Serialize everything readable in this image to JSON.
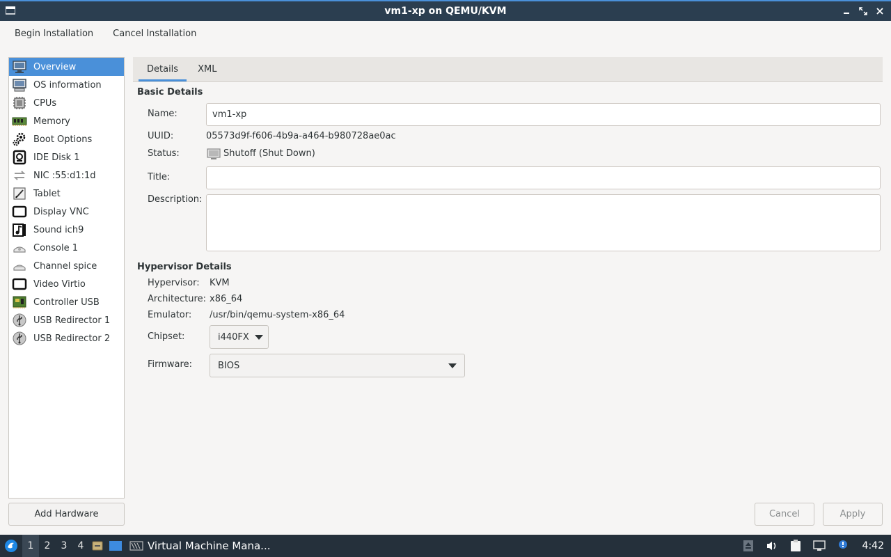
{
  "window": {
    "title": "vm1-xp on QEMU/KVM"
  },
  "menu": {
    "begin_install": "Begin Installation",
    "cancel_install": "Cancel Installation"
  },
  "sidebar": {
    "items": [
      {
        "label": "Overview",
        "icon": "monitor-icon"
      },
      {
        "label": "OS information",
        "icon": "os-info-icon"
      },
      {
        "label": "CPUs",
        "icon": "cpu-icon"
      },
      {
        "label": "Memory",
        "icon": "memory-icon"
      },
      {
        "label": "Boot Options",
        "icon": "gear-icon"
      },
      {
        "label": "IDE Disk 1",
        "icon": "disk-icon"
      },
      {
        "label": "NIC :55:d1:1d",
        "icon": "network-icon"
      },
      {
        "label": "Tablet",
        "icon": "tablet-icon"
      },
      {
        "label": "Display VNC",
        "icon": "display-icon"
      },
      {
        "label": "Sound ich9",
        "icon": "sound-icon"
      },
      {
        "label": "Console 1",
        "icon": "console-icon"
      },
      {
        "label": "Channel spice",
        "icon": "channel-icon"
      },
      {
        "label": "Video Virtio",
        "icon": "video-icon"
      },
      {
        "label": "Controller USB",
        "icon": "controller-icon"
      },
      {
        "label": "USB Redirector 1",
        "icon": "usb-icon"
      },
      {
        "label": "USB Redirector 2",
        "icon": "usb-icon"
      }
    ],
    "add_hardware": "Add Hardware"
  },
  "tabs": {
    "details": "Details",
    "xml": "XML"
  },
  "basic": {
    "heading": "Basic Details",
    "name_label": "Name:",
    "name_value": "vm1-xp",
    "uuid_label": "UUID:",
    "uuid_value": "05573d9f-f606-4b9a-a464-b980728ae0ac",
    "status_label": "Status:",
    "status_value": "Shutoff (Shut Down)",
    "title_label": "Title:",
    "title_value": "",
    "description_label": "Description:",
    "description_value": ""
  },
  "hypervisor": {
    "heading": "Hypervisor Details",
    "hypervisor_label": "Hypervisor:",
    "hypervisor_value": "KVM",
    "arch_label": "Architecture:",
    "arch_value": "x86_64",
    "emulator_label": "Emulator:",
    "emulator_value": "/usr/bin/qemu-system-x86_64",
    "chipset_label": "Chipset:",
    "chipset_value": "i440FX",
    "firmware_label": "Firmware:",
    "firmware_value": "BIOS"
  },
  "buttons": {
    "cancel": "Cancel",
    "apply": "Apply"
  },
  "taskbar": {
    "workspaces": [
      "1",
      "2",
      "3",
      "4"
    ],
    "app_title": "Virtual Machine Mana...",
    "clock": "4:42"
  },
  "colors": {
    "accent": "#4a90d9",
    "titlebar": "#2b3e50",
    "taskbar": "#25303b"
  }
}
